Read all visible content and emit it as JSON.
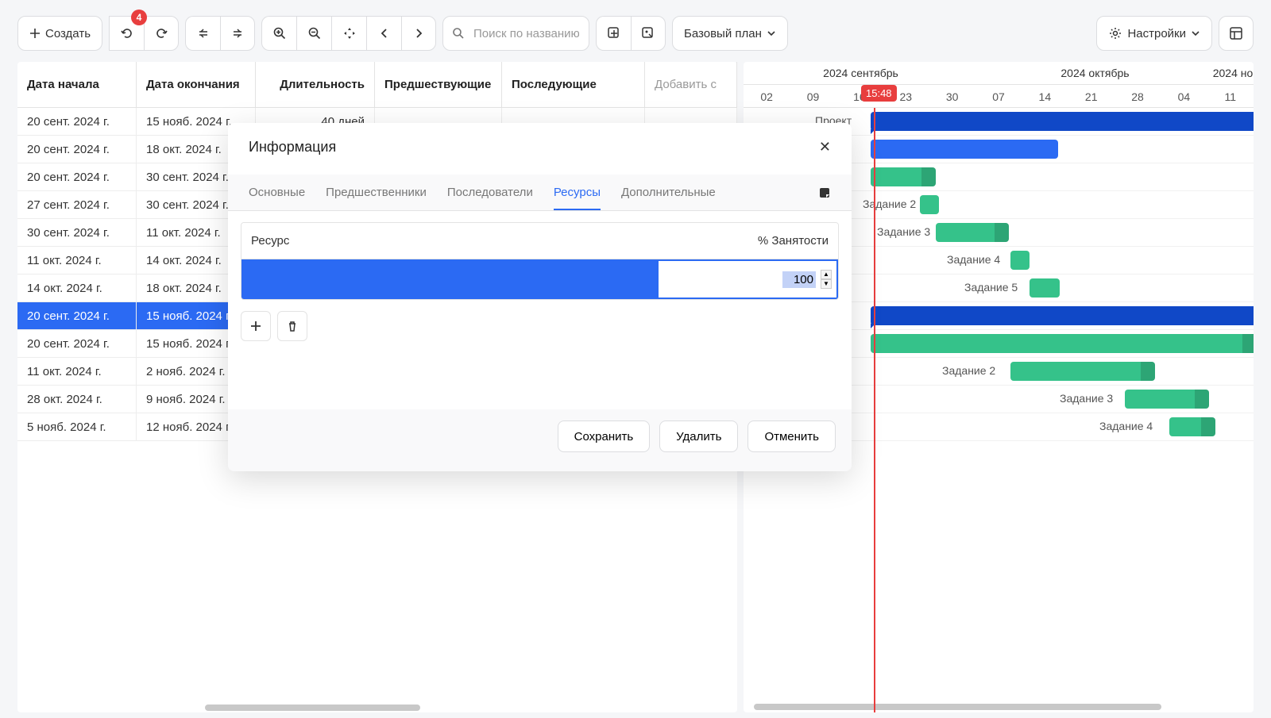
{
  "toolbar": {
    "create": "Создать",
    "undoBadge": "4",
    "baseline": "Базовый план",
    "searchPlaceholder": "Поиск по названию",
    "settings": "Настройки"
  },
  "grid": {
    "columns": {
      "start": "Дата начала",
      "end": "Дата окончания",
      "duration": "Длительность",
      "predecessors": "Предшествующие",
      "successors": "Последующие",
      "add": "Добавить с"
    },
    "rows": [
      {
        "start": "20 сент. 2024 г.",
        "end": "15 нояб. 2024 г.",
        "dur": "40 дней"
      },
      {
        "start": "20 сент. 2024 г.",
        "end": "18 окт. 2024 г.",
        "dur": ""
      },
      {
        "start": "20 сент. 2024 г.",
        "end": "30 сент. 2024 г.",
        "dur": ""
      },
      {
        "start": "27 сент. 2024 г.",
        "end": "30 сент. 2024 г.",
        "dur": ""
      },
      {
        "start": "30 сент. 2024 г.",
        "end": "11 окт. 2024 г.",
        "dur": ""
      },
      {
        "start": "11 окт. 2024 г.",
        "end": "14 окт. 2024 г.",
        "dur": ""
      },
      {
        "start": "14 окт. 2024 г.",
        "end": "18 окт. 2024 г.",
        "dur": ""
      },
      {
        "start": "20 сент. 2024 г.",
        "end": "15 нояб. 2024 г.",
        "dur": ""
      },
      {
        "start": "20 сент. 2024 г.",
        "end": "15 нояб. 2024 г.",
        "dur": ""
      },
      {
        "start": "11 окт. 2024 г.",
        "end": "2 нояб. 2024 г.",
        "dur": ""
      },
      {
        "start": "28 окт. 2024 г.",
        "end": "9 нояб. 2024 г.",
        "dur": ""
      },
      {
        "start": "5 нояб. 2024 г.",
        "end": "12 нояб. 2024 г.",
        "dur": ""
      }
    ],
    "selectedIndex": 7
  },
  "gantt": {
    "months": [
      "2024 сентябрь",
      "2024 октябрь",
      "2024 но"
    ],
    "days": [
      "02",
      "09",
      "16",
      "23",
      "30",
      "07",
      "14",
      "21",
      "28",
      "04",
      "11"
    ],
    "nowTime": "15:48",
    "labels": {
      "project": "Проект",
      "task2": "Задание 2",
      "task3": "Задание 3",
      "task4": "Задание 4",
      "task5": "Задание 5",
      "s2_task2": "Задание 2",
      "s2_task3": "Задание 3",
      "s2_task4": "Задание 4"
    }
  },
  "modal": {
    "title": "Информация",
    "tabs": {
      "general": "Основные",
      "predecessors": "Предшественники",
      "successors": "Последователи",
      "resources": "Ресурсы",
      "advanced": "Дополнительные"
    },
    "resource": {
      "colResource": "Ресурс",
      "colBusy": "% Занятости",
      "value": "100"
    },
    "buttons": {
      "save": "Сохранить",
      "delete": "Удалить",
      "cancel": "Отменить"
    }
  }
}
